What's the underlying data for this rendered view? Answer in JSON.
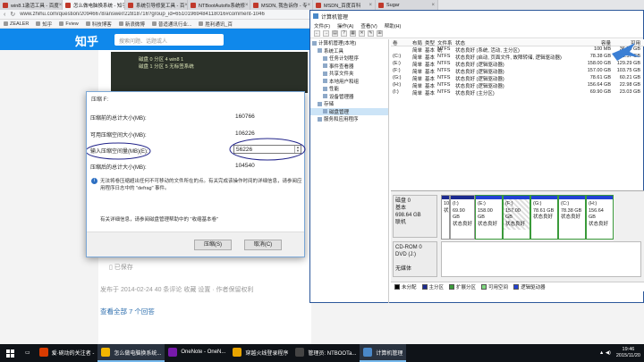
{
  "browser": {
    "tabs": [
      {
        "label": "win8.1激活工具 - 百度"
      },
      {
        "label": "怎么做电脑换系统 - 知乎",
        "active": true
      },
      {
        "label": "系统引导修复工具 - 百"
      },
      {
        "label": "NTBootAutofix系统修"
      },
      {
        "label": "MSDN, 我告诉你 - 专"
      },
      {
        "label": "MSDN_百度百科"
      },
      {
        "label": "Sugar"
      }
    ],
    "url": "www.zhihu.com/question/20946678/answer/22818716?group_id=65101969484118016#comment-1046",
    "bookmarks": [
      "ZEALER",
      "知乎",
      "Fview",
      "科技博客",
      "新浪微博",
      "普适通讯行业...",
      "胜利通讯_百"
    ],
    "site_logo": "知乎",
    "search_placeholder": "搜索问题、话题或人",
    "photo_lines": [
      "磁盘 0 分区 4 win8 1",
      "磁盘 1 分区 5 无标签系统"
    ],
    "saved_label": "已保存",
    "post_meta": "发布于 2014-02-24   40 条评论   收藏   设置 · 作者保留权利",
    "more_answers": "查看全部 7 个回答"
  },
  "dialog": {
    "title": "压缩 F:",
    "rows": [
      {
        "label": "压缩前的总计大小(MB):",
        "value": "160766"
      },
      {
        "label": "可用压缩空间大小(MB):",
        "value": "106226"
      }
    ],
    "input_label": "输入压缩空间量(MB)(E):",
    "input_value": "56226",
    "after_label": "压缩后的总计大小(MB):",
    "after_value": "104540",
    "note": "无法将卷压缩超出任何不可移动的文件所在的点。有关完成该操作时间的详细信息，请参阅应用程序日志中的 \"defrag\" 事件。",
    "help": "有关详细信息，请参阅磁盘管理帮助中的 \"收缩基本卷\"",
    "ok_label": "压缩(S)",
    "cancel_label": "取消(C)"
  },
  "cm": {
    "title": "计算机管理",
    "menus": [
      "文件(F)",
      "操作(A)",
      "查看(V)",
      "帮助(H)"
    ],
    "toolbar_icons": [
      "←",
      "→",
      "▤",
      "?",
      "▦",
      "✕",
      "✎",
      "⊞"
    ],
    "tree": [
      {
        "label": "计算机管理(本地)",
        "indent": 0
      },
      {
        "label": "系统工具",
        "indent": 1
      },
      {
        "label": "任务计划程序",
        "indent": 2
      },
      {
        "label": "事件查看器",
        "indent": 2
      },
      {
        "label": "共享文件夹",
        "indent": 2
      },
      {
        "label": "本地用户和组",
        "indent": 2
      },
      {
        "label": "性能",
        "indent": 2
      },
      {
        "label": "设备管理器",
        "indent": 2
      },
      {
        "label": "存储",
        "indent": 1
      },
      {
        "label": "磁盘管理",
        "indent": 2,
        "selected": true
      },
      {
        "label": "服务和应用程序",
        "indent": 1
      }
    ],
    "columns": [
      "卷",
      "布局",
      "类型",
      "文件系统",
      "状态",
      "容量",
      "可用"
    ],
    "volumes": [
      {
        "vol": "",
        "layout": "简单",
        "type": "基本",
        "fs": "NTFS",
        "status": "状态良好 (系统, 活动, 主分区)",
        "cap": "100 MB",
        "free": "36.59 GB"
      },
      {
        "vol": "(C:)",
        "layout": "简单",
        "type": "基本",
        "fs": "NTFS",
        "status": "状态良好 (启动, 页面文件, 故障转储, 逻辑驱动器)",
        "cap": "78.38 GB",
        "free": "45.57 GB"
      },
      {
        "vol": "(E:)",
        "layout": "简单",
        "type": "基本",
        "fs": "NTFS",
        "status": "状态良好 (逻辑驱动器)",
        "cap": "158.00 GB",
        "free": "129.29 GB"
      },
      {
        "vol": "(F:)",
        "layout": "简单",
        "type": "基本",
        "fs": "NTFS",
        "status": "状态良好 (逻辑驱动器)",
        "cap": "157.00 GB",
        "free": "103.75 GB"
      },
      {
        "vol": "(G:)",
        "layout": "简单",
        "type": "基本",
        "fs": "NTFS",
        "status": "状态良好 (逻辑驱动器)",
        "cap": "78.61 GB",
        "free": "60.21 GB"
      },
      {
        "vol": "(H:)",
        "layout": "简单",
        "type": "基本",
        "fs": "NTFS",
        "status": "状态良好 (逻辑驱动器)",
        "cap": "156.64 GB",
        "free": "22.98 GB"
      },
      {
        "vol": "(I:)",
        "layout": "简单",
        "type": "基本",
        "fs": "NTFS",
        "status": "状态良好 (主分区)",
        "cap": "69.90 GB",
        "free": "23.03 GB"
      }
    ],
    "disk0": {
      "name": "磁盘 0",
      "type": "基本",
      "size": "698.64 GB",
      "status": "联机"
    },
    "partitions": [
      {
        "name": "",
        "size": "10",
        "status": "状",
        "width": 10,
        "logical": false
      },
      {
        "name": "(I:)",
        "size": "69.90 GB",
        "status": "状态良好",
        "width": 28,
        "logical": false
      },
      {
        "name": "(E:)",
        "size": "158.00 GB",
        "status": "状态良好",
        "width": 31,
        "logical": true
      },
      {
        "name": "(F:)",
        "size": "157.00 GB",
        "status": "状态良好",
        "width": 31,
        "logical": true,
        "selected": true
      },
      {
        "name": "(G:)",
        "size": "78.61 GB",
        "status": "状态良好",
        "width": 31,
        "logical": true
      },
      {
        "name": "(C:)",
        "size": "78.38 GB",
        "status": "状态良好",
        "width": 31,
        "logical": true
      },
      {
        "name": "(H:)",
        "size": "156.64 GB",
        "status": "状态良好",
        "width": 31,
        "logical": true
      }
    ],
    "cdrom": {
      "name": "CD-ROM 0",
      "type": "DVD (J:)",
      "status": "无媒体"
    },
    "legend": [
      {
        "label": "未分配",
        "color": "#000000"
      },
      {
        "label": "主分区",
        "color": "#1b2a8f"
      },
      {
        "label": "扩展分区",
        "color": "#3a9a3a"
      },
      {
        "label": "可用空间",
        "color": "#7fd87f"
      },
      {
        "label": "逻辑驱动器",
        "color": "#2242d4"
      }
    ]
  },
  "taskbar": {
    "items": [
      {
        "label": "爱·碗动的关注者 -",
        "color": "#d83b01"
      },
      {
        "label": "怎么做电脑换系统...",
        "color": "#f2b600",
        "active": true
      },
      {
        "label": "OneNote - OneN...",
        "color": "#7719aa"
      },
      {
        "label": "穿越火线登录程序",
        "color": "#e8a400"
      },
      {
        "label": "管理员: NTBOOTa...",
        "color": "#444444"
      },
      {
        "label": "计算机管理",
        "color": "#4a88c8",
        "active": true
      }
    ],
    "time": "19:46",
    "date": "2015/11/20"
  }
}
